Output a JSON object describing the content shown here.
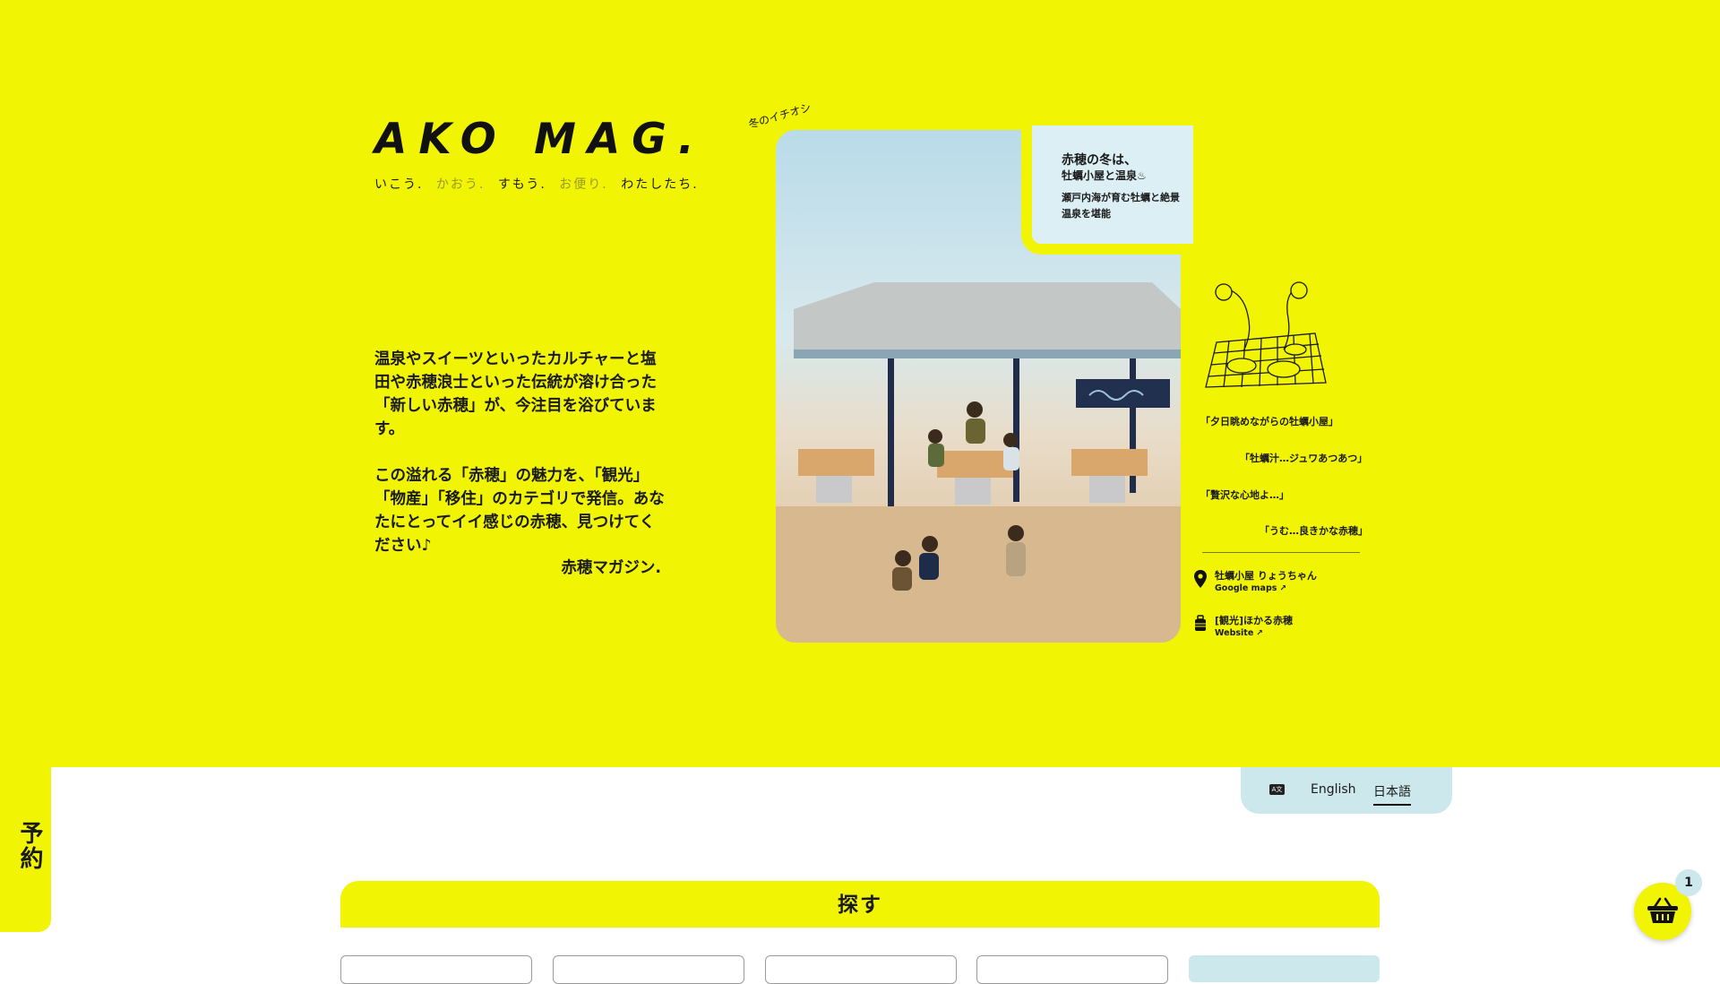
{
  "brand": {
    "logo": "AKO MAG.",
    "tagline": [
      {
        "text": "いこう.",
        "muted": false
      },
      {
        "text": "かおう.",
        "muted": true
      },
      {
        "text": "すもう.",
        "muted": false
      },
      {
        "text": "お便り.",
        "muted": true
      },
      {
        "text": "わたしたち.",
        "muted": false
      }
    ]
  },
  "intro": {
    "paragraph1": "温泉やスイーツといったカルチャーと塩田や赤穂浪士といった伝統が溶け合った「新しい赤穂」が、今注目を浴びています。",
    "paragraph2": "この溢れる「赤穂」の魅力を、「観光」「物産」「移住」のカテゴリで発信。あなたにとってイイ感じの赤穂、見つけてください♪",
    "signature": "赤穂マガジン."
  },
  "feature": {
    "tag": "冬のイチオシ",
    "caption_title": "赤穂の冬は、",
    "caption_subtitle": "牡蠣小屋と温泉♨",
    "caption_body": "瀬戸内海が育む牡蠣と絶景温泉を堪能",
    "quotes": [
      "「夕日眺めながらの牡蠣小屋」",
      "「牡蠣汁…ジュワあつあつ」",
      "「贅沢な心地よ…」",
      "「うむ…良きかな赤穂」"
    ],
    "location": {
      "name": "牡蠣小屋 りょうちゃん",
      "link": "Google maps"
    },
    "article": {
      "name": "[観光]ほかる赤穂",
      "link": "Website"
    }
  },
  "reserve_tab": "予約",
  "language": {
    "icon": "translate-icon",
    "english": "English",
    "japanese": "日本語",
    "selected": "日本語"
  },
  "search": {
    "title": "探す"
  },
  "cart": {
    "count": "1"
  },
  "colors": {
    "accent": "#f1f403",
    "light_blue": "#cce8ec"
  }
}
